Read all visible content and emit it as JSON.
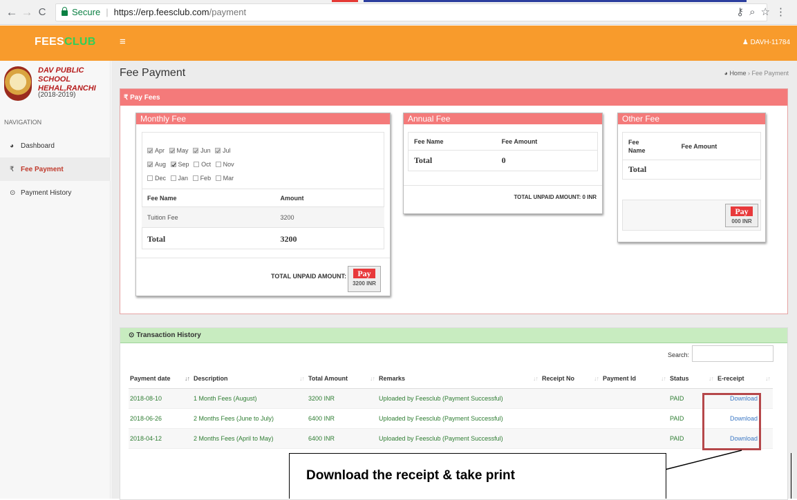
{
  "browser": {
    "secure_label": "Secure",
    "url_host": "https://erp.feesclub.com",
    "url_path": "/payment"
  },
  "topnav": {
    "logo_fees": "FEES",
    "logo_club": "CLUB",
    "user": "DAVH-11784"
  },
  "sidebar": {
    "school_name_line1": "DAV PUBLIC SCHOOL",
    "school_name_line2": "HEHAL,RANCHI",
    "session": "(2018-2019)",
    "nav_heading": "NAVIGATION",
    "items": [
      {
        "label": "Dashboard",
        "icon": "dashboard-icon"
      },
      {
        "label": "Fee Payment",
        "icon": "rupee-icon"
      },
      {
        "label": "Payment History",
        "icon": "clock-icon"
      }
    ]
  },
  "page": {
    "title": "Fee Payment",
    "breadcrumb_home": "Home",
    "breadcrumb_current": "Fee Payment"
  },
  "pay_fees": {
    "header": "₹ Pay Fees",
    "monthly": {
      "title": "Monthly Fee",
      "months": [
        {
          "name": "Apr",
          "checked": true
        },
        {
          "name": "May",
          "checked": true
        },
        {
          "name": "Jun",
          "checked": true
        },
        {
          "name": "Jul",
          "checked": true
        },
        {
          "name": "Aug",
          "checked": true
        },
        {
          "name": "Sep",
          "checked": true
        },
        {
          "name": "Oct",
          "checked": false
        },
        {
          "name": "Nov",
          "checked": false
        },
        {
          "name": "Dec",
          "checked": false
        },
        {
          "name": "Jan",
          "checked": false
        },
        {
          "name": "Feb",
          "checked": false
        },
        {
          "name": "Mar",
          "checked": false
        }
      ],
      "col_fee_name": "Fee Name",
      "col_amount": "Amount",
      "row_name": "Tuition Fee",
      "row_amount": "3200",
      "total_label": "Total",
      "total_value": "3200",
      "unpaid_label": "TOTAL UNPAID AMOUNT:",
      "pay_label": "Pay",
      "pay_amount": "3200 INR"
    },
    "annual": {
      "title": "Annual Fee",
      "col_fee_name": "Fee Name",
      "col_amount": "Fee Amount",
      "total_label": "Total",
      "total_value": "0",
      "unpaid_label": "TOTAL UNPAID AMOUNT: 0 INR"
    },
    "other": {
      "title": "Other Fee",
      "col_fee_name_1": "Fee",
      "col_fee_name_2": "Name",
      "col_amount": "Fee Amount",
      "total_label": "Total",
      "pay_label": "Pay",
      "pay_amount": "000 INR"
    }
  },
  "transactions": {
    "header": "Transaction History",
    "search_label": "Search:",
    "columns": [
      "Payment date",
      "Description",
      "Total Amount",
      "Remarks",
      "Receipt No",
      "Payment Id",
      "Status",
      "E-receipt"
    ],
    "rows": [
      {
        "date": "2018-08-10",
        "desc": "1 Month Fees (August)",
        "amount": "3200 INR",
        "remarks": "Uploaded by Feesclub (Payment Successful)",
        "receipt": "",
        "payid": "",
        "status": "PAID",
        "ereceipt": "Download"
      },
      {
        "date": "2018-06-26",
        "desc": "2 Months Fees (June to July)",
        "amount": "6400 INR",
        "remarks": "Uploaded by Feesclub (Payment Successful)",
        "receipt": "",
        "payid": "",
        "status": "PAID",
        "ereceipt": "Download"
      },
      {
        "date": "2018-04-12",
        "desc": "2 Months Fees (April to May)",
        "amount": "6400 INR",
        "remarks": "Uploaded by Feesclub (Payment Successful)",
        "receipt": "",
        "payid": "",
        "status": "PAID",
        "ereceipt": "Download"
      }
    ]
  },
  "annotation": {
    "callout_text": "Download the receipt & take print"
  },
  "colors": {
    "topnav": "#f89b2c",
    "pay_header": "#f47a7a",
    "tx_header": "#c8ecc0",
    "highlight": "#b5474a"
  }
}
